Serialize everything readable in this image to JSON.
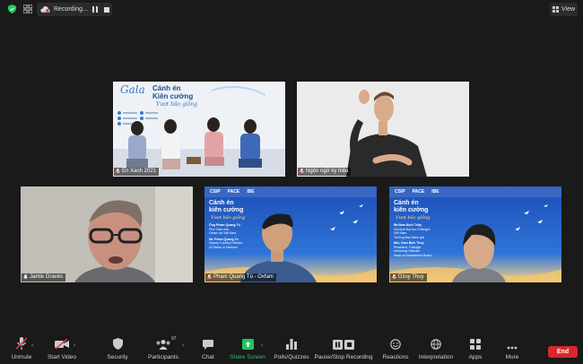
{
  "top_bar": {
    "recording_label": "Recording...",
    "view_label": "View"
  },
  "tiles": [
    {
      "name": "Én Xanh 2021",
      "mic_muted": true
    },
    {
      "name": "Ngôn ngữ ký hiệu",
      "mic_muted": true
    },
    {
      "name": "Jamie Graves",
      "mic_muted": false
    },
    {
      "name": "Phạm Quang Tú - Oxfam",
      "mic_muted": true
    },
    {
      "name": "Dzuy Thuy",
      "mic_muted": true
    }
  ],
  "gala_banner": {
    "script_title": "Gala",
    "title_line1": "Cánh én",
    "title_line2": "Kiên cường",
    "subtitle": "Vượt bão giông"
  },
  "event_slide_left": {
    "title_line1": "Cánh én",
    "title_line2": "kiên cường",
    "subtitle": "Vượt bão giông",
    "speaker1_vi": "Ông Phạm Quang Tú",
    "speaker1_vi_role1": "Phó Giám đốc",
    "speaker1_vi_role2": "Oxfam tại Việt Nam",
    "speaker1_en": "Mr. Pham Quang Tu",
    "speaker1_en_role1": "Deputy Country Director",
    "speaker1_en_role2": "of Oxfam in Vietnam",
    "logos": [
      "CSIP",
      "PACE",
      "IBE"
    ]
  },
  "event_slide_right": {
    "title_line1": "Cánh én",
    "title_line2": "kiên cường",
    "subtitle": "Vượt bão giông",
    "speaker_vi": "Bà Đàm Bích Thủy",
    "speaker_vi_role1": "Chủ tịch Đại học Fulbright",
    "speaker_vi_role2": "Việt Nam",
    "speaker_vi_role3": "Trưởng Ban Đánh giá",
    "speaker_en": "Mrs. Dam Bich Thuy",
    "speaker_en_role1": "President, Fulbright",
    "speaker_en_role2": "University Vietnam",
    "speaker_en_role3": "Head of Assessment Board",
    "logos": [
      "CSIP",
      "PACE",
      "IBE"
    ]
  },
  "toolbar": {
    "unmute": "Unmute",
    "start_video": "Start Video",
    "security": "Security",
    "participants": "Participants",
    "participants_count": "97",
    "chat": "Chat",
    "share_screen": "Share Screen",
    "polls": "Polls/Quizzes",
    "recording": "Pause/Stop Recording",
    "reactions": "Reactions",
    "interpretation": "Interpretation",
    "apps": "Apps",
    "more": "More",
    "end": "End"
  },
  "colors": {
    "background": "#1a1a1a",
    "share_green": "#22c55e",
    "end_red": "#d9272e",
    "slide_blue": "#1f5fc9"
  }
}
